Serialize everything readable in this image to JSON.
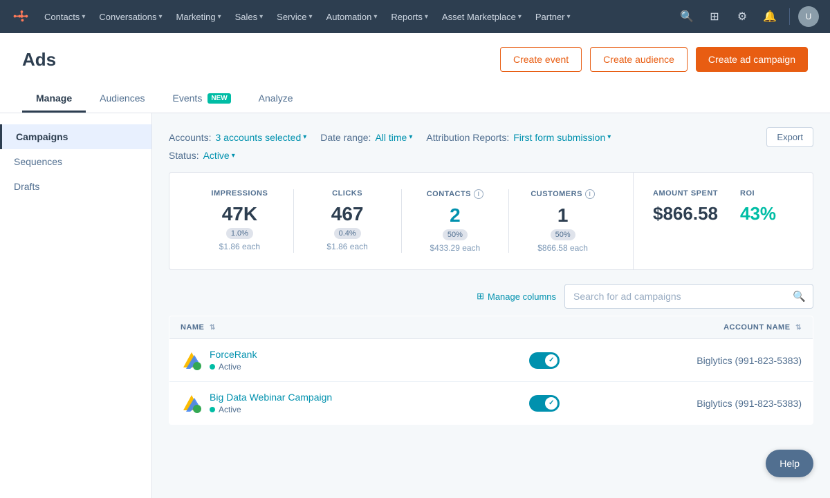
{
  "nav": {
    "items": [
      {
        "label": "Contacts",
        "id": "contacts"
      },
      {
        "label": "Conversations",
        "id": "conversations"
      },
      {
        "label": "Marketing",
        "id": "marketing"
      },
      {
        "label": "Sales",
        "id": "sales"
      },
      {
        "label": "Service",
        "id": "service"
      },
      {
        "label": "Automation",
        "id": "automation"
      },
      {
        "label": "Reports",
        "id": "reports"
      },
      {
        "label": "Asset Marketplace",
        "id": "asset-marketplace"
      },
      {
        "label": "Partner",
        "id": "partner"
      }
    ]
  },
  "page": {
    "title": "Ads",
    "tabs": [
      {
        "label": "Manage",
        "id": "manage",
        "active": true,
        "badge": null
      },
      {
        "label": "Audiences",
        "id": "audiences",
        "active": false,
        "badge": null
      },
      {
        "label": "Events",
        "id": "events",
        "active": false,
        "badge": "NEW"
      },
      {
        "label": "Analyze",
        "id": "analyze",
        "active": false,
        "badge": null
      }
    ]
  },
  "header_actions": {
    "create_event": "Create event",
    "create_audience": "Create audience",
    "create_campaign": "Create ad campaign"
  },
  "sidebar": {
    "items": [
      {
        "label": "Campaigns",
        "id": "campaigns",
        "active": true
      },
      {
        "label": "Sequences",
        "id": "sequences",
        "active": false
      },
      {
        "label": "Drafts",
        "id": "drafts",
        "active": false
      }
    ]
  },
  "filters": {
    "accounts_label": "Accounts:",
    "accounts_value": "3 accounts selected",
    "date_range_label": "Date range:",
    "date_range_value": "All time",
    "attribution_label": "Attribution Reports:",
    "attribution_value": "First form submission",
    "status_label": "Status:",
    "status_value": "Active",
    "export_label": "Export"
  },
  "stats": {
    "impressions": {
      "label": "IMPRESSIONS",
      "value": "47K",
      "pill": "1.0%",
      "sub": "$1.86 each"
    },
    "clicks": {
      "label": "CLICKS",
      "value": "467",
      "pill": "0.4%",
      "sub": "$1.86 each"
    },
    "contacts": {
      "label": "CONTACTS",
      "value": "2",
      "pill": "50%",
      "sub": "$433.29 each"
    },
    "customers": {
      "label": "CUSTOMERS",
      "value": "1",
      "pill": "50%",
      "sub": "$866.58 each"
    },
    "amount_spent": {
      "label": "AMOUNT SPENT",
      "value": "$866.58"
    },
    "roi": {
      "label": "ROI",
      "value": "43%"
    }
  },
  "table": {
    "manage_columns": "Manage columns",
    "search_placeholder": "Search for ad campaigns",
    "columns": [
      {
        "label": "NAME",
        "id": "name",
        "sortable": true
      },
      {
        "label": "ACCOUNT NAME",
        "id": "account_name",
        "sortable": true
      }
    ],
    "rows": [
      {
        "id": "forcerank",
        "name": "ForceRank",
        "status": "Active",
        "account_name": "Biglytics (991-823-5383)",
        "toggle_on": true
      },
      {
        "id": "big-data-webinar",
        "name": "Big Data Webinar Campaign",
        "status": "Active",
        "account_name": "Biglytics (991-823-5383)",
        "toggle_on": true
      }
    ]
  },
  "help": {
    "label": "Help"
  }
}
